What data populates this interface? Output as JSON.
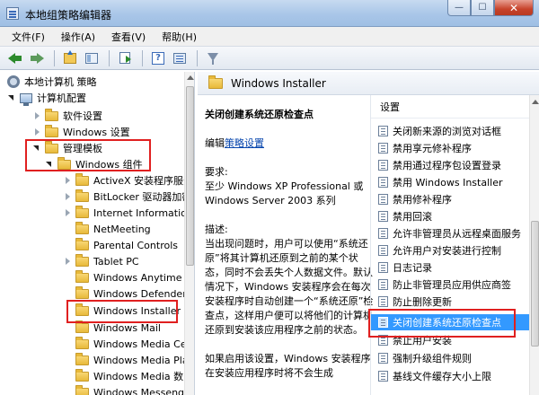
{
  "window": {
    "title": "本地组策略编辑器"
  },
  "menu": [
    "文件(F)",
    "操作(A)",
    "查看(V)",
    "帮助(H)"
  ],
  "tree": {
    "root": "本地计算机 策略",
    "computer_config": "计算机配置",
    "software_settings": "软件设置",
    "windows_settings": "Windows 设置",
    "admin_templates": "管理模板",
    "windows_components": "Windows 组件",
    "items": [
      "ActiveX 安装程序服务",
      "BitLocker 驱动器加密",
      "Internet Information",
      "NetMeeting",
      "Parental Controls",
      "Tablet PC",
      "Windows Anytime U",
      "Windows Defender",
      "Windows Installer",
      "Windows Mail",
      "Windows Media Ce",
      "Windows Media Pla",
      "Windows Media 数",
      "Windows Messeng"
    ]
  },
  "header": {
    "title": "Windows Installer"
  },
  "description": {
    "setting_title": "关闭创建系统还原检查点",
    "edit_prefix": "编辑",
    "edit_link": "策略设置",
    "requirements_label": "要求:",
    "requirements_text": "至少 Windows XP Professional 或 Windows Server 2003 系列",
    "desc_label": "描述:",
    "desc_text": "当出现问题时，用户可以使用“系统还原”将其计算机还原到之前的某个状态，同时不会丢失个人数据文件。默认情况下，Windows 安装程序会在每次安装程序时自动创建一个“系统还原”检查点，这样用户便可以将他们的计算机还原到安装该应用程序之前的状态。",
    "more_text": "如果启用该设置，Windows 安装程序在安装应用程序时将不会生成"
  },
  "list": {
    "header": "设置",
    "items": [
      "关闭新来源的浏览对话框",
      "禁用享元修补程序",
      "禁用通过程序包设置登录",
      "禁用 Windows Installer",
      "禁用修补程序",
      "禁用回滚",
      "允许非管理员从远程桌面服务",
      "允许用户对安装进行控制",
      "日志记录",
      "防止非管理员应用供应商签",
      "防止删除更新",
      "关闭创建系统还原检查点",
      "禁止用户安装",
      "强制升级组件规则",
      "基线文件缓存大小上限"
    ]
  }
}
